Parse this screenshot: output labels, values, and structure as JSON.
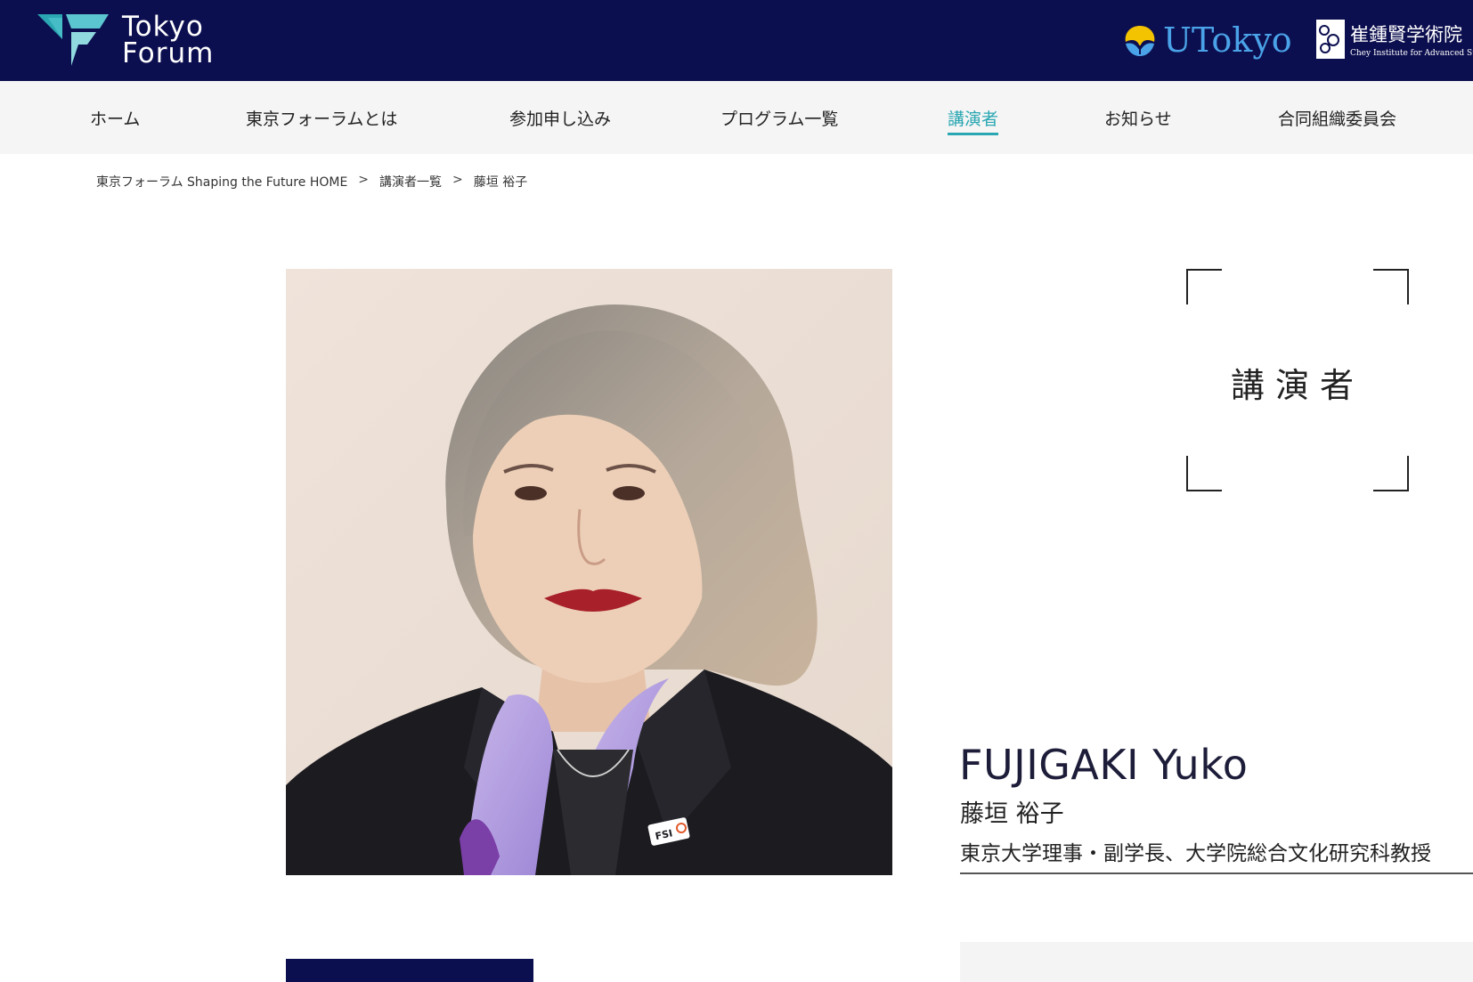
{
  "header": {
    "logo_line1": "Tokyo",
    "logo_line2": "Forum",
    "utokyo_label": "UTokyo",
    "chey_title": "崔鍾賢学術院",
    "chey_subtitle": "Chey Institute for Advanced Studies",
    "background_color": "#0c0f4f"
  },
  "nav": {
    "items": [
      {
        "label": "ホーム"
      },
      {
        "label": "東京フォーラムとは"
      },
      {
        "label": "参加申し込み"
      },
      {
        "label": "プログラム一覧"
      },
      {
        "label": "講演者",
        "active": true
      },
      {
        "label": "お知らせ"
      },
      {
        "label": "合同組織委員会"
      }
    ],
    "active_color": "#2aa7b2"
  },
  "breadcrumb": {
    "items": [
      "東京フォーラム Shaping the Future HOME",
      "講演者一覧",
      "藤垣 裕子"
    ],
    "separator": ">"
  },
  "section_label": "講演者",
  "speaker": {
    "name_en": "FUJIGAKI Yuko",
    "name_ja": "藤垣 裕子",
    "title": "東京大学理事・副学長、大学院総合文化研究科教授",
    "pin_label": "FSI"
  }
}
